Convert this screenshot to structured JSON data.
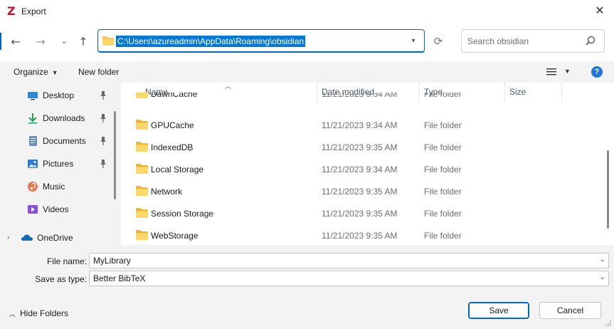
{
  "window": {
    "title": "Export",
    "app_icon": "Z",
    "close_icon": "✕"
  },
  "navigation": {
    "back_icon": "←",
    "forward_icon": "→",
    "recent_icon": "⌄",
    "up_icon": "↑",
    "address": "C:\\Users\\azureadmin\\AppData\\Roaming\\obsidian",
    "refresh_icon": "⟳",
    "search_placeholder": "Search obsidian"
  },
  "toolbar": {
    "organize_label": "Organize",
    "new_folder_label": "New folder",
    "help_label": "?"
  },
  "sidebar": {
    "items": [
      {
        "label": "Desktop",
        "icon": "desktop-icon",
        "pinned": true
      },
      {
        "label": "Downloads",
        "icon": "download-icon",
        "pinned": true
      },
      {
        "label": "Documents",
        "icon": "documents-icon",
        "pinned": true
      },
      {
        "label": "Pictures",
        "icon": "pictures-icon",
        "pinned": true
      },
      {
        "label": "Music",
        "icon": "music-icon",
        "pinned": false
      },
      {
        "label": "Videos",
        "icon": "videos-icon",
        "pinned": false
      },
      {
        "label": "OneDrive",
        "icon": "onedrive-icon",
        "pinned": false
      }
    ]
  },
  "filelist": {
    "columns": [
      "Name",
      "Date modified",
      "Type",
      "Size"
    ],
    "rows": [
      {
        "name": "DawnCache",
        "date": "11/21/2023 9:34 AM",
        "type": "File folder"
      },
      {
        "name": "GPUCache",
        "date": "11/21/2023 9:34 AM",
        "type": "File folder"
      },
      {
        "name": "IndexedDB",
        "date": "11/21/2023 9:35 AM",
        "type": "File folder"
      },
      {
        "name": "Local Storage",
        "date": "11/21/2023 9:34 AM",
        "type": "File folder"
      },
      {
        "name": "Network",
        "date": "11/21/2023 9:35 AM",
        "type": "File folder"
      },
      {
        "name": "Session Storage",
        "date": "11/21/2023 9:35 AM",
        "type": "File folder"
      },
      {
        "name": "WebStorage",
        "date": "11/21/2023 9:35 AM",
        "type": "File folder"
      }
    ]
  },
  "form": {
    "file_name_label": "File name:",
    "file_name_value": "MyLibrary",
    "save_type_label": "Save as type:",
    "save_type_value": "Better BibTeX"
  },
  "footer": {
    "hide_folders_label": "Hide Folders",
    "save_label": "Save",
    "cancel_label": "Cancel"
  },
  "colors": {
    "accent": "#0067c0",
    "folder": "#f8c74a",
    "pane_bg": "#f3f3f3"
  }
}
